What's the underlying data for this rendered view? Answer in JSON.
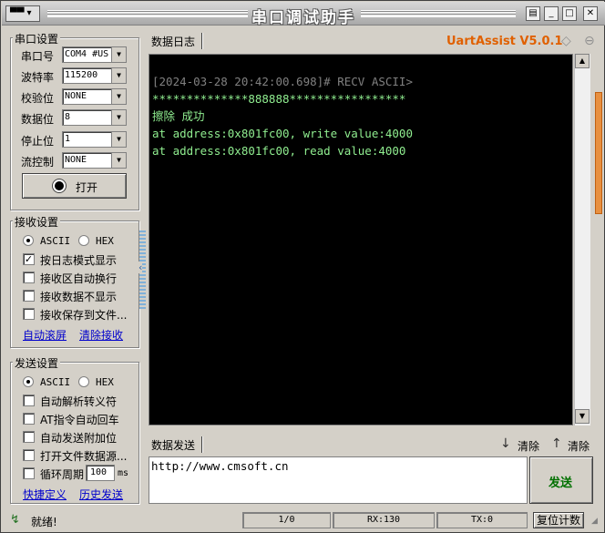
{
  "title": "串口调试助手",
  "brand": "UartAssist V5.0.1",
  "serial": {
    "group_title": "串口设置",
    "port_label": "串口号",
    "port_value": "COM4 #US",
    "baud_label": "波特率",
    "baud_value": "115200",
    "parity_label": "校验位",
    "parity_value": "NONE",
    "databits_label": "数据位",
    "databits_value": "8",
    "stopbits_label": "停止位",
    "stopbits_value": "1",
    "flow_label": "流控制",
    "flow_value": "NONE",
    "open_button": "打开"
  },
  "receive": {
    "group_title": "接收设置",
    "ascii": "ASCII",
    "hex": "HEX",
    "opt_log_mode": "按日志模式显示",
    "opt_auto_wrap": "接收区自动换行",
    "opt_hide": "接收数据不显示",
    "opt_save": "接收保存到文件...",
    "link_autoscroll": "自动滚屏",
    "link_clear": "清除接收"
  },
  "send": {
    "group_title": "发送设置",
    "ascii": "ASCII",
    "hex": "HEX",
    "opt_escape": "自动解析转义符",
    "opt_at": "AT指令自动回车",
    "opt_append": "自动发送附加位",
    "opt_file": "打开文件数据源...",
    "opt_loop": "循环周期",
    "loop_value": "100",
    "loop_unit": "ms",
    "link_shortcut": "快捷定义",
    "link_history": "历史发送"
  },
  "log": {
    "tab": "数据日志",
    "lines": [
      "[2024-03-28 20:42:00.698]# RECV ASCII>",
      "**************888888*****************",
      "擦除 成功",
      "at address:0x801fc00, write value:4000",
      "at address:0x801fc00, read value:4000"
    ]
  },
  "sendarea": {
    "tab": "数据发送",
    "clear1": "清除",
    "clear2": "清除",
    "input_value": "http://www.cmsoft.cn",
    "send_button": "发送"
  },
  "statusbar": {
    "ready": "就绪!",
    "page": "1/0",
    "rx": "RX:130",
    "tx": "TX:0",
    "reset": "复位计数"
  },
  "colors": {
    "brand": "#e06000",
    "console_bg": "#000000",
    "console_header": "#808080",
    "console_text": "#90ee90",
    "send_green": "#007000"
  }
}
